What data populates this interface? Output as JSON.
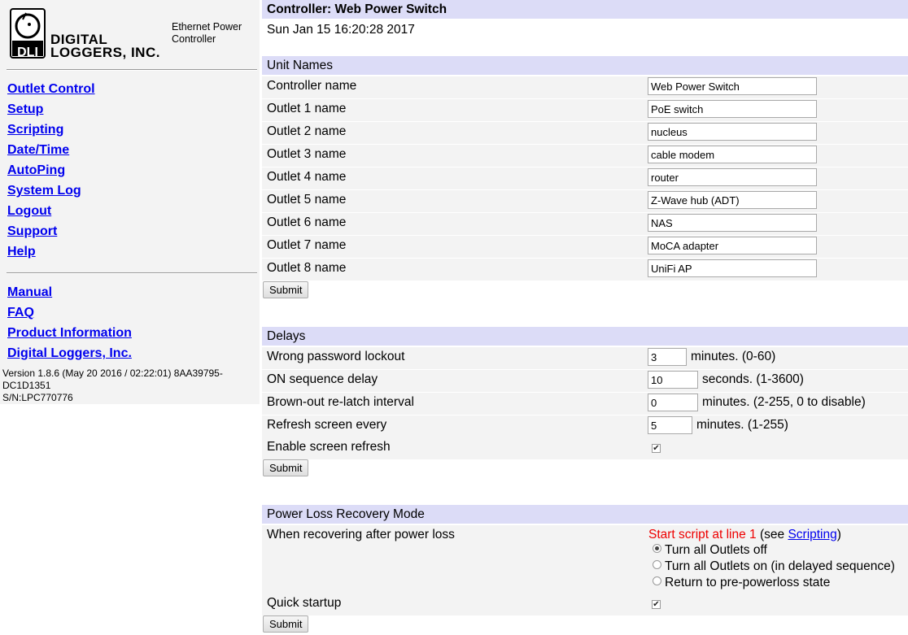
{
  "sidebar": {
    "logo_text_line1": "DIGITAL",
    "logo_text_line2": "LOGGERS, INC.",
    "logo_mark_text": "DLI",
    "tagline_line1": "Ethernet Power",
    "tagline_line2": "Controller",
    "nav": [
      "Outlet Control",
      "Setup",
      "Scripting",
      "Date/Time",
      "AutoPing",
      "System Log",
      "Logout",
      "Support",
      "Help"
    ],
    "links": [
      "Manual",
      "FAQ",
      "Product Information",
      "Digital Loggers, Inc."
    ],
    "version_line1": "Version 1.8.6 (May 20 2016 / 02:22:01) 8AA39795-",
    "version_line2": "DC1D1351",
    "version_line3": "S/N:LPC770776"
  },
  "header": {
    "title": "Controller: Web Power Switch",
    "timestamp": "Sun Jan 15 16:20:28 2017"
  },
  "unit_names": {
    "heading": "Unit Names",
    "controller_label": "Controller name",
    "controller_value": "Web Power Switch",
    "outlets": [
      {
        "label": "Outlet 1 name",
        "value": "PoE switch"
      },
      {
        "label": "Outlet 2 name",
        "value": "nucleus"
      },
      {
        "label": "Outlet 3 name",
        "value": "cable modem"
      },
      {
        "label": "Outlet 4 name",
        "value": "router"
      },
      {
        "label": "Outlet 5 name",
        "value": "Z-Wave hub (ADT)"
      },
      {
        "label": "Outlet 6 name",
        "value": "NAS"
      },
      {
        "label": "Outlet 7 name",
        "value": "MoCA adapter"
      },
      {
        "label": "Outlet 8 name",
        "value": "UniFi AP"
      }
    ],
    "submit_label": "Submit"
  },
  "delays": {
    "heading": "Delays",
    "rows": [
      {
        "label": "Wrong password lockout",
        "value": "3",
        "unit": "minutes. (0-60)"
      },
      {
        "label": "ON sequence delay",
        "value": "10",
        "unit": "seconds. (1-3600)"
      },
      {
        "label": "Brown-out re-latch interval",
        "value": "0",
        "unit": "minutes. (2-255, 0 to disable)"
      },
      {
        "label": "Refresh screen every",
        "value": "5",
        "unit": "minutes. (1-255)"
      }
    ],
    "refresh_label": "Enable screen refresh",
    "refresh_checked": true,
    "submit_label": "Submit"
  },
  "power_loss": {
    "heading": "Power Loss Recovery Mode",
    "recover_label": "When recovering after power loss",
    "script_note_prefix": "Start script at line 1",
    "script_note_open": " (see ",
    "script_note_link": "Scripting",
    "script_note_close": ")",
    "options": [
      "Turn all Outlets off",
      "Turn all Outlets on (in delayed sequence)",
      "Return to pre-powerloss state"
    ],
    "selected_index": 0,
    "quick_label": "Quick startup",
    "quick_checked": true,
    "submit_label": "Submit"
  },
  "colors": {
    "header_bg": "#dcdcf7",
    "row_bg": "#f3f3f3",
    "link": "#0000ee",
    "warning": "#ee0000"
  }
}
